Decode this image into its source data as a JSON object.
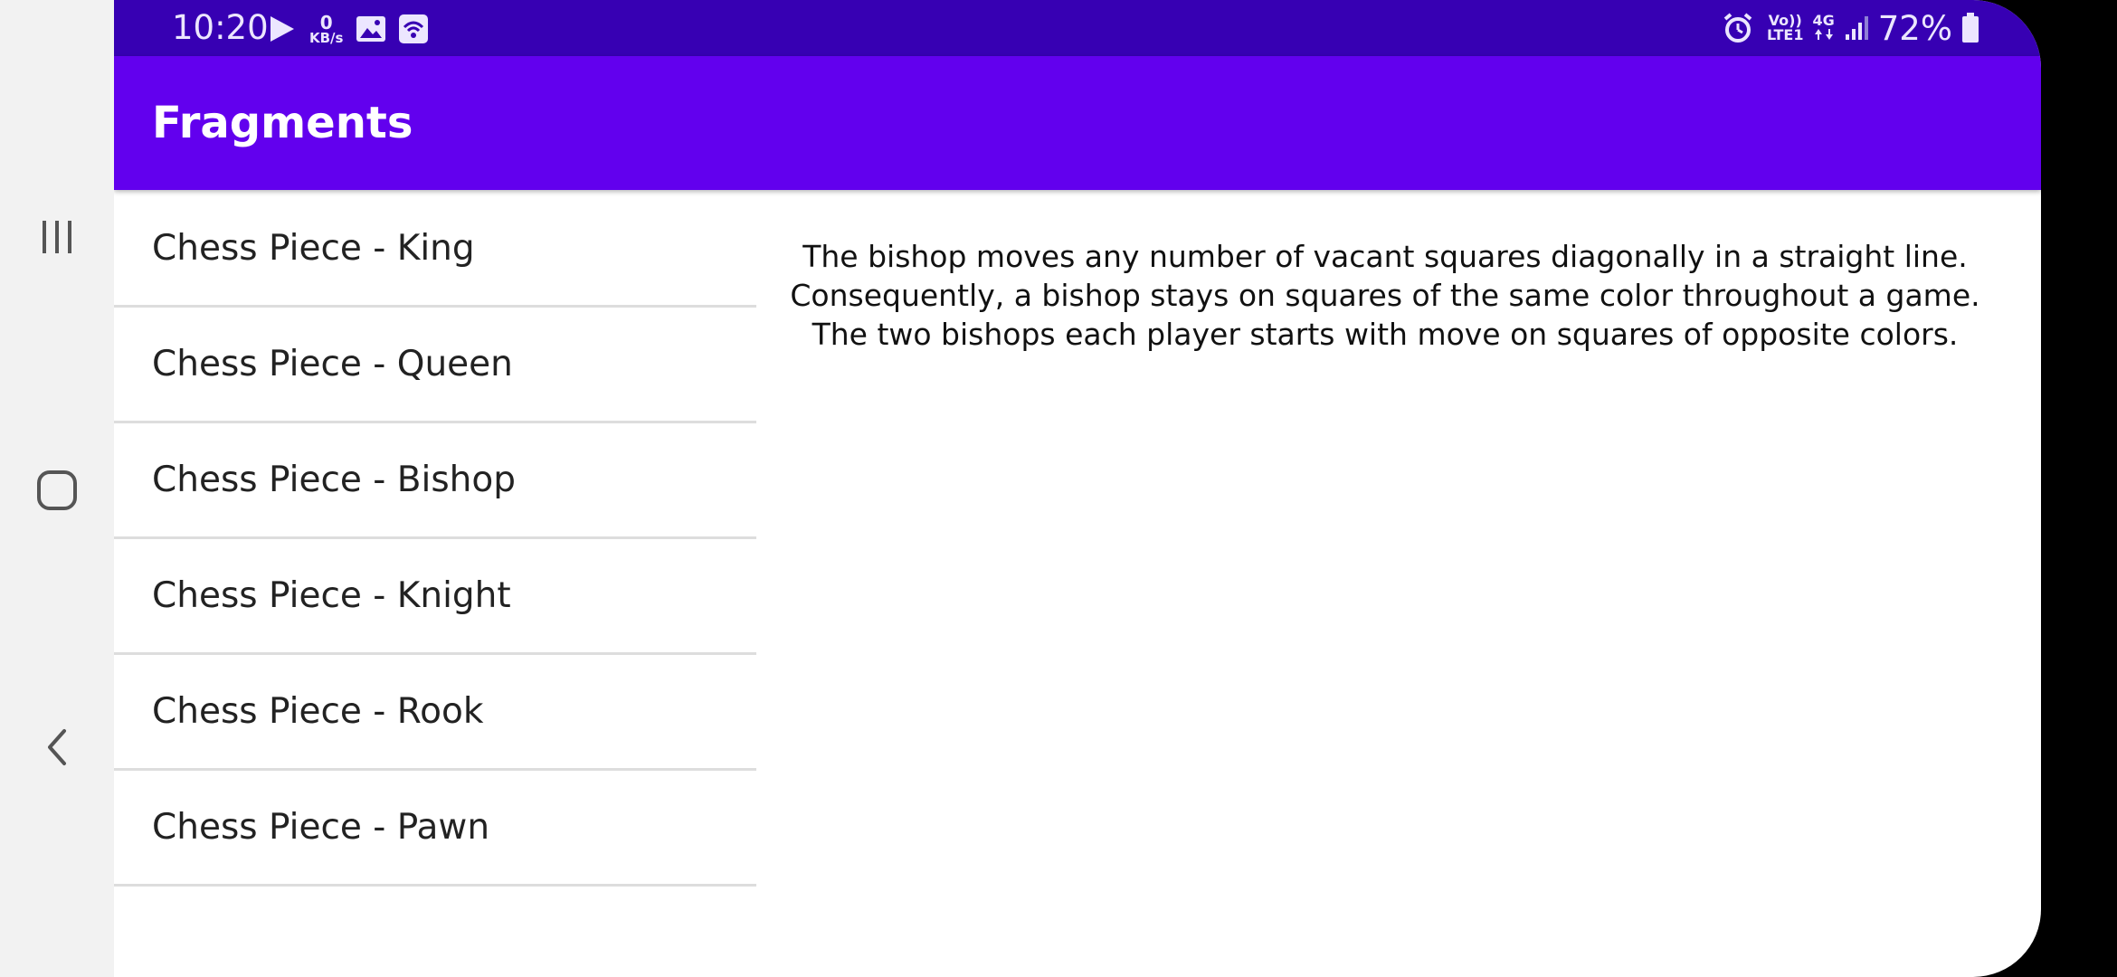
{
  "status_bar": {
    "time": "10:20",
    "data_speed_value": "0",
    "data_speed_unit": "KB/s",
    "network_top": "Vo))",
    "network_bottom": "LTE1",
    "network_type": "4G",
    "battery_percent": "72%"
  },
  "toolbar": {
    "title": "Fragments"
  },
  "list": {
    "items": [
      {
        "label": "Chess Piece - King"
      },
      {
        "label": "Chess Piece - Queen"
      },
      {
        "label": "Chess Piece - Bishop"
      },
      {
        "label": "Chess Piece - Knight"
      },
      {
        "label": "Chess Piece - Rook"
      },
      {
        "label": "Chess Piece - Pawn"
      }
    ]
  },
  "detail": {
    "text": "The bishop moves any number of vacant squares diagonally in a straight line. Consequently, a bishop stays on squares of the same color throughout a game. The two bishops each player starts with move on squares of opposite colors."
  },
  "colors": {
    "status_bar": "#3700b3",
    "toolbar": "#6200ee",
    "nav_bar": "#f2f2f2"
  },
  "icons": {
    "nav": [
      "recent-apps-icon",
      "home-icon",
      "back-icon"
    ],
    "status_left": [
      "play-store-icon",
      "gallery-icon",
      "wifi-hotspot-icon"
    ],
    "status_right": [
      "alarm-icon",
      "signal-icon",
      "battery-icon"
    ]
  }
}
